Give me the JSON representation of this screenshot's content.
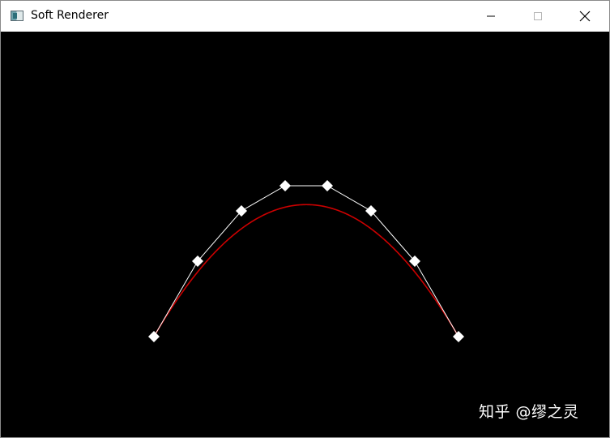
{
  "window": {
    "title": "Soft Renderer",
    "icon": "app-window-icon",
    "controls": [
      "minimize-icon",
      "maximize-icon",
      "close-icon"
    ]
  },
  "canvas": {
    "background": "#000000",
    "control_polygon_color": "#ffffff",
    "curve_color": "#cc0000",
    "marker_color": "#ffffff",
    "marker_shape": "diamond"
  },
  "watermark": {
    "text": "知乎 @缪之灵"
  }
}
